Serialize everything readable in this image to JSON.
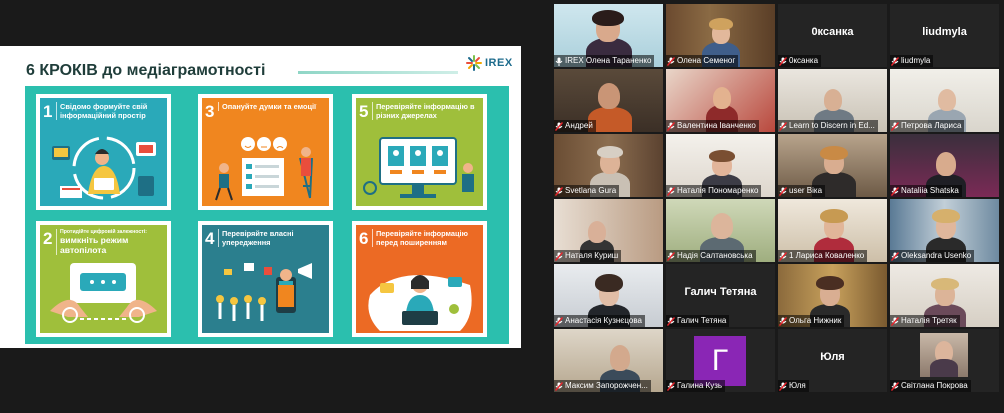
{
  "slide": {
    "title": "6 КРОКІВ до медіаграмотності",
    "logo_text": "IREX",
    "colors": {
      "board": "#2bbfae",
      "card1": "#2aa9b9",
      "card2": "#9fbf3b",
      "card3": "#f0861f",
      "card4": "#2b7f8e",
      "card5": "#9fbf3b",
      "card6": "#ec6a24"
    },
    "cards": [
      {
        "num": "1",
        "text": "Свідомо формуйте свій інформаційний простір"
      },
      {
        "num": "3",
        "text": "Опануйте думки та емоції"
      },
      {
        "num": "5",
        "text": "Перевіряйте інформацію в різних джерелах"
      },
      {
        "num": "2",
        "small": "Протидійте цифровій залежності:",
        "big": "вимкніть режим автопілота"
      },
      {
        "num": "4",
        "text": "Перевіряйте власні упередження"
      },
      {
        "num": "6",
        "text": "Перевіряйте інформацію перед поширенням"
      }
    ]
  },
  "gallery": {
    "participants": [
      {
        "name": "IREX Олена Тараненко",
        "active": true
      },
      {
        "name": "Олена Семеног"
      },
      {
        "name": "0ксанка",
        "display": "0ксанка"
      },
      {
        "name": "liudmyla",
        "display": "liudmyla"
      },
      {
        "name": "Андрей"
      },
      {
        "name": "Валентина Іванченко"
      },
      {
        "name": "Learn to Discern in Ed..."
      },
      {
        "name": "Петрова Лариса"
      },
      {
        "name": "Svetlana Gura"
      },
      {
        "name": "Наталія Пономаренко"
      },
      {
        "name": "user Віка"
      },
      {
        "name": "Nataliia Shatska"
      },
      {
        "name": "Наталя Куриш"
      },
      {
        "name": "Надія Салтановська"
      },
      {
        "name": "1 Лариса Коваленко"
      },
      {
        "name": "Oleksandra Usenko"
      },
      {
        "name": "Анастасія Кузнєцова"
      },
      {
        "name": "Галич Тетяна",
        "display": "Галич Тетяна"
      },
      {
        "name": "Ольга Нижник"
      },
      {
        "name": "Наталія Третяк"
      },
      {
        "name": "Максим Запорожчен..."
      },
      {
        "name": "Галина Кузь",
        "letter": "Г"
      },
      {
        "name": "Юля",
        "display": "Юля"
      },
      {
        "name": "Світлана Покрова"
      }
    ]
  }
}
